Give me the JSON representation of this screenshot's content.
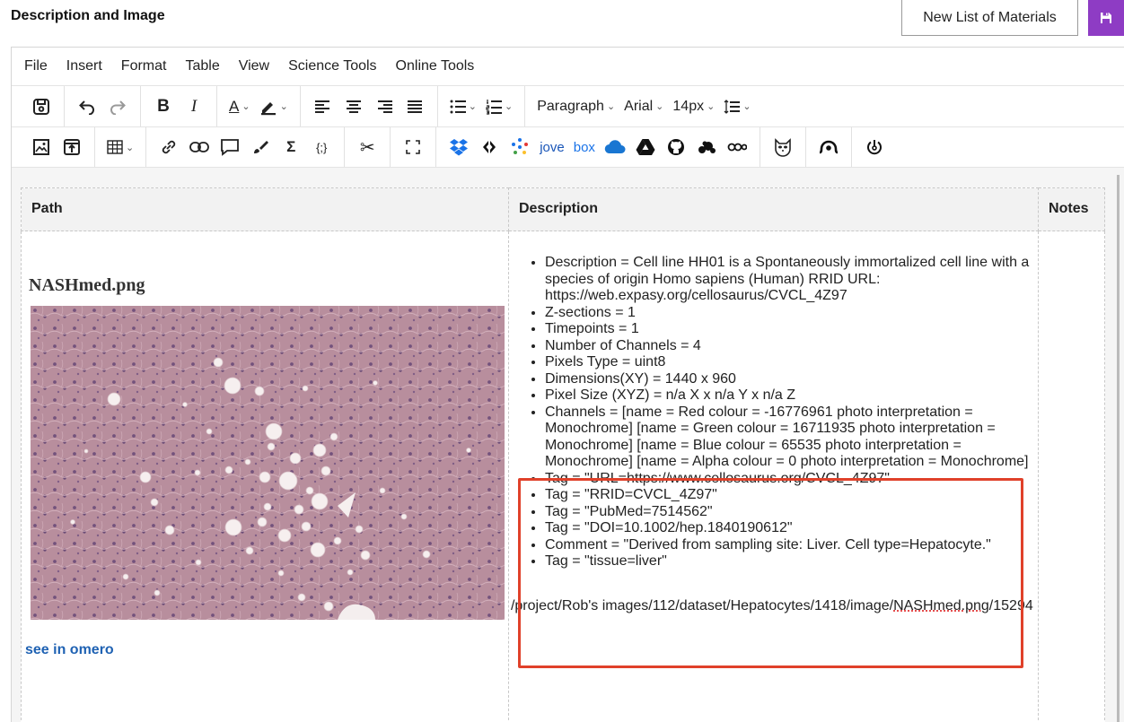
{
  "header": {
    "section_title": "Description and Image",
    "new_list_label": "New List of Materials",
    "save_icon": "floppy-disk-icon",
    "accent_color": "#8e3cc4"
  },
  "menubar": {
    "items": [
      "File",
      "Insert",
      "Format",
      "Table",
      "View",
      "Science Tools",
      "Online Tools"
    ]
  },
  "toolbar": {
    "bold": "B",
    "italic": "I",
    "text_color": "A",
    "block_format": "Paragraph",
    "font_family": "Arial",
    "font_size": "14px",
    "brand_jove": "jove",
    "brand_box": "box"
  },
  "table": {
    "headers": [
      "Path",
      "Description",
      "Notes"
    ],
    "file_name": "NASHmed.png",
    "omero_link": "see in omero",
    "description_items": [
      "Description = Cell line HH01 is a Spontaneously immortalized cell line with a species of origin Homo sapiens (Human) RRID URL: https://web.expasy.org/cellosaurus/CVCL_4Z97",
      "Z-sections = 1",
      "Timepoints = 1",
      "Number of Channels = 4",
      "Pixels Type = uint8",
      "Dimensions(XY) = 1440 x 960",
      "Pixel Size (XYZ) = n/a X x n/a Y x n/a Z",
      "Channels = [name = Red colour = -16776961 photo interpretation = Monochrome] [name = Green colour = 16711935 photo interpretation = Monochrome] [name = Blue colour = 65535 photo interpretation = Monochrome] [name = Alpha colour = 0 photo interpretation = Monochrome]",
      "Tag = \"URL=https://www.cellosaurus.org/CVCL_4Z97\"",
      "Tag = \"RRID=CVCL_4Z97\"",
      "Tag = \"PubMed=7514562\"",
      "Tag = \"DOI=10.1002/hep.1840190612\"",
      "Comment = \"Derived from sampling site: Liver. Cell type=Hepatocyte.\"",
      "Tag = \"tissue=liver\""
    ],
    "path_prefix": "/project/Rob's images/112/dataset/Hepatocytes/1418/image/",
    "path_file": "NASHmed.png",
    "path_suffix": "/15294"
  }
}
